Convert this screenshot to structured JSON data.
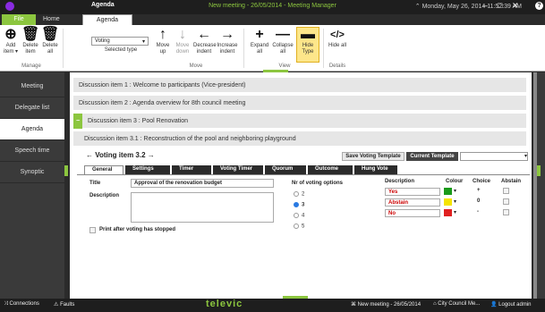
{
  "titlebar": {
    "context_tab": "Agenda",
    "title": "New meeting - 26/05/2014 - Meeting Manager",
    "datetime": "Monday, May 26, 2014 11:52:39 AM",
    "help": "?",
    "min": "–",
    "max": "□",
    "close": "✕"
  },
  "tabs": {
    "file": "File",
    "home": "Home",
    "agenda": "Agenda"
  },
  "ribbon": {
    "add_item": "Add item ▾",
    "delete_item": "Delete item",
    "delete_all": "Delete all",
    "manage_label": "Manage",
    "voting_select": "Voting",
    "selected_type": "Selected type",
    "move_up": "Move up",
    "move_down": "Move down",
    "decrease_indent": "Decrease indent",
    "increase_indent": "Increase indent",
    "move_label": "Move",
    "expand_all": "Expand all",
    "collapse_all": "Collapse all",
    "hide_type": "Hide Type",
    "view_label": "View",
    "hide_all": "Hide all",
    "details_label": "Details"
  },
  "sidebar": {
    "items": [
      {
        "label": "Meeting"
      },
      {
        "label": "Delegate list"
      },
      {
        "label": "Agenda"
      },
      {
        "label": "Speech time"
      },
      {
        "label": "Synoptic"
      }
    ]
  },
  "agenda": {
    "items": [
      "Discussion item 1 : Welcome to participants (Vice-president)",
      "Discussion item 2 : Agenda overview for 8th council meeting",
      "Discussion item 3 : Pool Renovation",
      "Discussion item 3.1 : Reconstruction of the pool and neighboring playground"
    ]
  },
  "voting": {
    "item_title": "Voting item 3.2",
    "save_template": "Save Voting Template",
    "current_template": "Current Template",
    "tabs": [
      "General",
      "Settings",
      "Timer",
      "Voting Timer",
      "Quorum",
      "Outcome",
      "Hung Vote"
    ],
    "title_label": "Title",
    "title_value": "Approval of the renovation budget",
    "description_label": "Description",
    "print_label": "Print after voting has stopped",
    "nr_options_label": "Nr of voting options",
    "options": [
      "2",
      "3",
      "4",
      "5"
    ],
    "selected_option": "3",
    "col_description": "Description",
    "col_colour": "Colour",
    "col_choice": "Choice",
    "col_abstain": "Abstain",
    "rows": [
      {
        "desc": "Yes",
        "color": "#1a9a1a",
        "choice": "+"
      },
      {
        "desc": "Abstain",
        "color": "#f5e400",
        "choice": "0"
      },
      {
        "desc": "No",
        "color": "#e02020",
        "choice": "-"
      }
    ]
  },
  "status": {
    "connections": "Connections",
    "faults": "Faults",
    "brand": "televic",
    "meeting": "New meeting - 26/05/2014",
    "council": "City Council Me...",
    "logout": "Logout admin"
  }
}
